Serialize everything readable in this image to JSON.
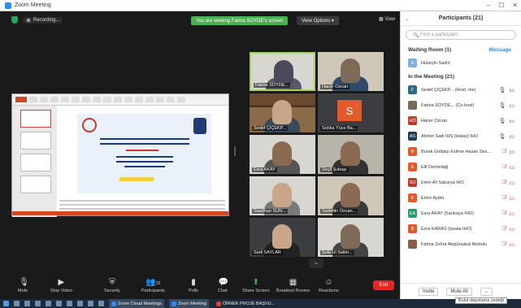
{
  "window": {
    "title": "Zoom Meeting"
  },
  "share_banner": {
    "text": "You are viewing Fatma SOYDE's screen",
    "view_options": "View Options ▾"
  },
  "top": {
    "recording": "Recording...",
    "view": "View"
  },
  "slide": {
    "lines": [
      "İMAM HATİP OKULLARI",
      "EĞİTİMDE REHBERLİK VE DESTEKLEME MODELİ",
      "2021 YILI DESTEK PROGRAMI",
      "DEĞERLENDİRME TOPLANTISI"
    ]
  },
  "tiles": [
    {
      "name": "Fatma SOYDE...",
      "active": true
    },
    {
      "name": "Hacer Özcan"
    },
    {
      "name": "Sedef ÇİÇEKP..."
    },
    {
      "name": "Sıdıka Yüce Ba...",
      "initial": "S"
    },
    {
      "name": "Esra AKAY",
      "active": false
    },
    {
      "name": "Seçil Şubaşı"
    },
    {
      "name": "Saadhan SÜN..."
    },
    {
      "name": "Sadettin Özcan..."
    },
    {
      "name": "Sadi SAYLAR"
    },
    {
      "name": "Şule Ül Salim..."
    }
  ],
  "toolbar": {
    "mute": "Mute",
    "stop_video": "Stop Video",
    "security": "Security",
    "participants": "Participants",
    "participants_count": "22",
    "polls": "Polls",
    "chat": "Chat",
    "share_screen": "Share Screen",
    "breakout": "Breakout Rooms",
    "reactions": "Reactions",
    "end": "End"
  },
  "panel": {
    "title": "Participants (21)",
    "search_placeholder": "Find a participant",
    "waiting": "Waiting Room (1)",
    "message": "Message",
    "waiting_person": {
      "initials": "H",
      "name": "Hüseyin Sadıri",
      "color": "#7fb0e0"
    },
    "in_meeting": "In the Meeting (21)",
    "people": [
      {
        "initials": "F",
        "name": "Sedef ÇİÇEKP... (Host, me)",
        "color": "#2b6a8a"
      },
      {
        "initials": "",
        "name": "Fatma SOYDE... (Co-host)",
        "color": "#7a6a5a"
      },
      {
        "initials": "HÖ",
        "name": "Hacer Özcan",
        "color": "#c0392b"
      },
      {
        "initials": "AS",
        "name": "Ahmet Sadi İHŞ (Hatay) İHO",
        "color": "#1f3b55"
      },
      {
        "initials": "B",
        "name": "Burak Golbaşı Eslime Hasan Sez...",
        "color": "#e35b2b"
      },
      {
        "initials": "E",
        "name": "Elif Demirdağ",
        "color": "#e35b2b"
      },
      {
        "initials": "SO",
        "name": "Emin Ali Sakarya İHO",
        "color": "#c0392b"
      },
      {
        "initials": "E",
        "name": "Emre Aydın",
        "color": "#e35b2b"
      },
      {
        "initials": "EA",
        "name": "Esra AKAY (Sarıkaya İHO)",
        "color": "#2a9d6a"
      },
      {
        "initials": "B",
        "name": "Esra KARAS (Ipsala İHO)",
        "color": "#e35b2b"
      },
      {
        "initials": "",
        "name": "Fatma Zehra Akgünsakal İlkokulu",
        "color": "#8a5a4a"
      }
    ],
    "invite": "Invite",
    "mute_all": "Mute All",
    "more": "..."
  },
  "taskbar": {
    "apps": [
      "Zoom Cloud Meetings",
      "Zoom Meeting",
      "ÖRNEK PROJE BAŞVU..."
    ],
    "tooltip": "Bulut depolama yedeği"
  }
}
